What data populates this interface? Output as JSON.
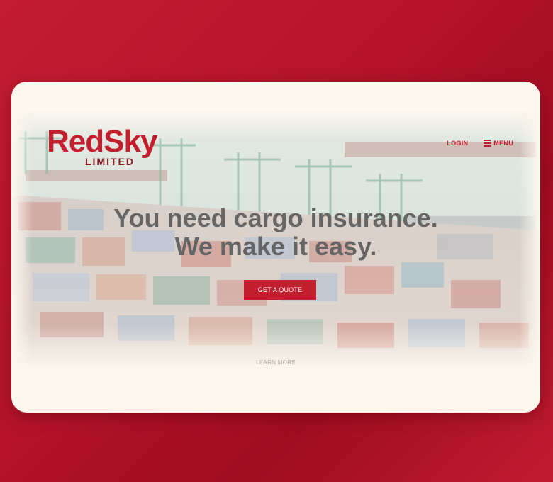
{
  "brand": {
    "name": "RedSky",
    "sub": "LIMITED"
  },
  "nav": {
    "login": "LOGIN",
    "menu": "MENU"
  },
  "hero": {
    "line1": "You need cargo insurance.",
    "line2": "We make it easy.",
    "cta": "GET A QUOTE",
    "learn_more": "LEARN MORE"
  },
  "colors": {
    "brand_red": "#c3202f",
    "card_bg": "#fdf7ee",
    "headline": "#666565"
  }
}
